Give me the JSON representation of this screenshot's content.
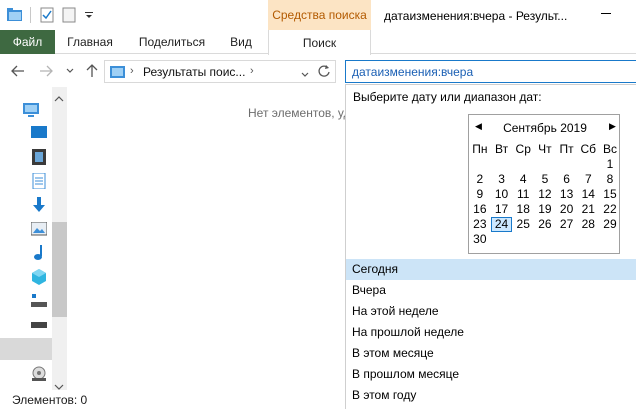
{
  "window": {
    "title": "датаизменения:вчера - Результ...",
    "contextual_tab": "Средства поиска"
  },
  "ribbon": {
    "tabs": [
      "Файл",
      "Главная",
      "Поделиться",
      "Вид",
      "Поиск"
    ]
  },
  "address": {
    "path": "Результаты поис...",
    "search_query": "датаизменения:вчера"
  },
  "content": {
    "empty_message": "Нет элементов, уд"
  },
  "status": {
    "items_label": "Элементов: 0"
  },
  "date_picker": {
    "caption": "Выберите дату или диапазон дат:",
    "month_year": "Сентябрь 2019",
    "weekdays": [
      "Пн",
      "Вт",
      "Ср",
      "Чт",
      "Пт",
      "Сб",
      "Вс"
    ],
    "weeks": [
      [
        "",
        "",
        "",
        "",
        "",
        "",
        "1"
      ],
      [
        "2",
        "3",
        "4",
        "5",
        "6",
        "7",
        "8"
      ],
      [
        "9",
        "10",
        "11",
        "12",
        "13",
        "14",
        "15"
      ],
      [
        "16",
        "17",
        "18",
        "19",
        "20",
        "21",
        "22"
      ],
      [
        "23",
        "24",
        "25",
        "26",
        "27",
        "28",
        "29"
      ],
      [
        "30",
        "",
        "",
        "",
        "",
        "",
        ""
      ]
    ],
    "today": "24",
    "quick_options": [
      "Сегодня",
      "Вчера",
      "На этой неделе",
      "На прошлой неделе",
      "В этом месяце",
      "В прошлом месяце",
      "В этом году"
    ],
    "highlighted_option": "Сегодня"
  },
  "colors": {
    "file_tab": "#3e6941",
    "contextual_tab_bg": "#fce4c4",
    "accent": "#1979ca",
    "selection": "#cce4f7"
  }
}
